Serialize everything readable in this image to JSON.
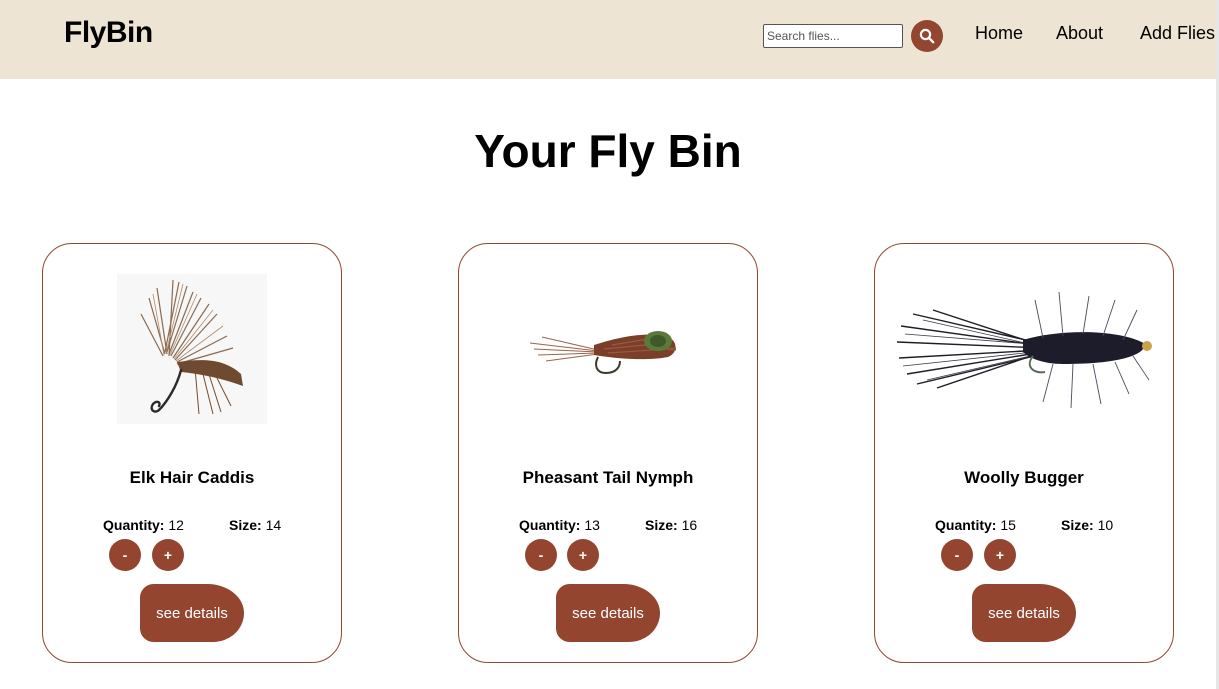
{
  "header": {
    "brand": "FlyBin",
    "search": {
      "placeholder": "Search flies...",
      "value": "",
      "button_icon": "search-icon"
    },
    "nav": [
      "Home",
      "About",
      "Add Flies"
    ]
  },
  "main": {
    "title": "Your Fly Bin",
    "cards": [
      {
        "name": "Elk Hair Caddis",
        "quantity_label": "Quantity:",
        "quantity": "12",
        "size_label": "Size:",
        "size": "14",
        "decrement": "-",
        "increment": "+",
        "details": "see details",
        "image": "elk-hair-caddis-fly"
      },
      {
        "name": "Pheasant Tail Nymph",
        "quantity_label": "Quantity:",
        "quantity": "13",
        "size_label": "Size:",
        "size": "16",
        "decrement": "-",
        "increment": "+",
        "details": "see details",
        "image": "pheasant-tail-nymph-fly"
      },
      {
        "name": "Woolly Bugger",
        "quantity_label": "Quantity:",
        "quantity": "15",
        "size_label": "Size:",
        "size": "10",
        "decrement": "-",
        "increment": "+",
        "details": "see details",
        "image": "woolly-bugger-fly"
      }
    ]
  },
  "colors": {
    "navbar": "#ede4d3",
    "accent": "#934530",
    "background": "#ffffff"
  }
}
